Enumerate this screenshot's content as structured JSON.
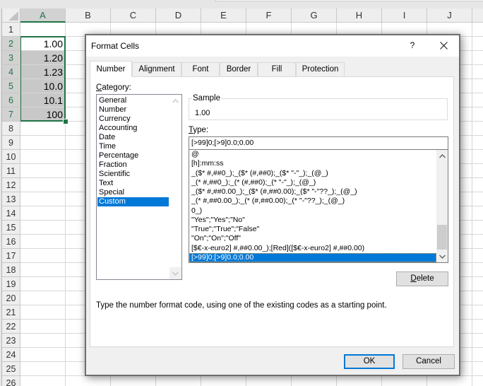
{
  "spreadsheet": {
    "columns": [
      "A",
      "B",
      "C",
      "D",
      "E",
      "F",
      "G",
      "H",
      "I",
      "J"
    ],
    "rows": [
      "1",
      "2",
      "3",
      "4",
      "5",
      "6",
      "7",
      "8",
      "9",
      "10",
      "11",
      "12",
      "13",
      "14",
      "15",
      "16",
      "17",
      "18",
      "19",
      "20",
      "21",
      "22",
      "23",
      "24",
      "25",
      "26"
    ],
    "selection": "A2:A7",
    "active_cell": "A2",
    "cells": [
      {
        "ref": "A2",
        "col": "A",
        "row": 2,
        "value": "1.00"
      },
      {
        "ref": "A3",
        "col": "A",
        "row": 3,
        "value": "1.20"
      },
      {
        "ref": "A4",
        "col": "A",
        "row": 4,
        "value": "1.23"
      },
      {
        "ref": "A5",
        "col": "A",
        "row": 5,
        "value": "10.0"
      },
      {
        "ref": "A6",
        "col": "A",
        "row": 6,
        "value": "10.1"
      },
      {
        "ref": "A7",
        "col": "A",
        "row": 7,
        "value": "100"
      }
    ],
    "accent_color": "#217346"
  },
  "dialog": {
    "title": "Format Cells",
    "help_label": "?",
    "close_icon": "close-icon",
    "tabs": [
      "Number",
      "Alignment",
      "Font",
      "Border",
      "Fill",
      "Protection"
    ],
    "active_tab": "Number",
    "category_label": {
      "key": "C",
      "rest": "ategory:"
    },
    "categories": [
      "General",
      "Number",
      "Currency",
      "Accounting",
      "Date",
      "Time",
      "Percentage",
      "Fraction",
      "Scientific",
      "Text",
      "Special",
      "Custom"
    ],
    "selected_category": "Custom",
    "sample_label": "Sample",
    "sample_value": "1.00",
    "type_label": {
      "key": "T",
      "rest": "ype:"
    },
    "type_value": "[>99]0;[>9]0.0;0.00",
    "type_list": [
      "@",
      "[h]:mm:ss",
      "_($* #,##0_);_($* (#,##0);_($* \"-\"_);_(@_)",
      "_(* #,##0_);_(* (#,##0);_(* \"-\"_);_(@_)",
      "_($* #,##0.00_);_($* (#,##0.00);_($* \"-\"??_);_(@_)",
      "_(* #,##0.00_);_(* (#,##0.00);_(* \"-\"??_);_(@_)",
      "0_)",
      "\"Yes\";\"Yes\";\"No\"",
      "\"True\";\"True\";\"False\"",
      "\"On\";\"On\";\"Off\"",
      "[$€-x-euro2] #,##0.00_);[Red]([$€-x-euro2] #,##0.00)",
      "[>99]0;[>9]0.0;0.00"
    ],
    "selected_type": "[>99]0;[>9]0.0;0.00",
    "delete_label": {
      "key": "D",
      "rest": "elete"
    },
    "description": "Type the number format code, using one of the existing codes as a starting point.",
    "ok_label": "OK",
    "cancel_label": "Cancel",
    "selection_color": "#0078d7"
  }
}
